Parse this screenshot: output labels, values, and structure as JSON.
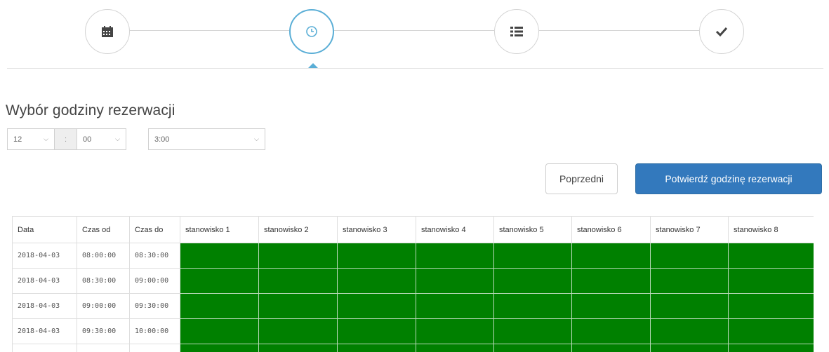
{
  "wizard": {
    "steps": [
      {
        "icon": "calendar-icon",
        "active": false
      },
      {
        "icon": "clock-icon",
        "active": true
      },
      {
        "icon": "list-icon",
        "active": false
      },
      {
        "icon": "check-icon",
        "active": false
      }
    ],
    "accent": "#5aaed6"
  },
  "section_title": "Wybór godziny rezerwacji",
  "selects": {
    "hour": "12",
    "separator": ":",
    "minute": "00",
    "duration": "3:00"
  },
  "buttons": {
    "previous": "Poprzedni",
    "confirm": "Potwierdź godzinę rezerwacji"
  },
  "colors": {
    "primary": "#3379bd",
    "available": "#008000"
  },
  "table": {
    "headers": [
      "Data",
      "Czas od",
      "Czas do",
      "stanowisko 1",
      "stanowisko 2",
      "stanowisko 3",
      "stanowisko 4",
      "stanowisko 5",
      "stanowisko 6",
      "stanowisko 7",
      "stanowisko 8"
    ],
    "rows": [
      {
        "date": "2018-04-03",
        "from": "08:00:00",
        "to": "08:30:00"
      },
      {
        "date": "2018-04-03",
        "from": "08:30:00",
        "to": "09:00:00"
      },
      {
        "date": "2018-04-03",
        "from": "09:00:00",
        "to": "09:30:00"
      },
      {
        "date": "2018-04-03",
        "from": "09:30:00",
        "to": "10:00:00"
      },
      {
        "date": "",
        "from": "",
        "to": ""
      }
    ]
  }
}
